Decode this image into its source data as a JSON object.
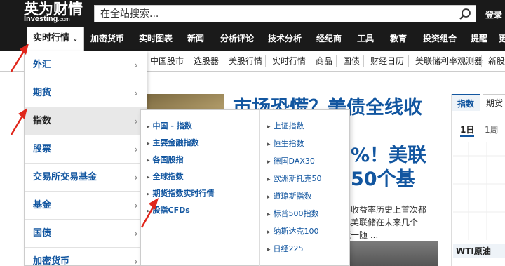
{
  "header": {
    "logo_cn": "英为财情",
    "logo_en": "Investing",
    "logo_en_suffix": ".com",
    "search_placeholder": "在全站搜索...",
    "login": "登录"
  },
  "main_nav": [
    {
      "label": "实时行情",
      "active": true
    },
    {
      "label": "加密货币"
    },
    {
      "label": "实时图表"
    },
    {
      "label": "新闻"
    },
    {
      "label": "分析评论"
    },
    {
      "label": "技术分析"
    },
    {
      "label": "经纪商"
    },
    {
      "label": "工具"
    },
    {
      "label": "教育"
    },
    {
      "label": "投资组合"
    },
    {
      "label": "提醒"
    },
    {
      "label": "更"
    }
  ],
  "sub_nav": [
    "中国股市",
    "选股器",
    "美股行情",
    "实时行情",
    "商品",
    "国债",
    "财经日历",
    "美联储利率观测器",
    "新股"
  ],
  "menu1": [
    {
      "label": "外汇"
    },
    {
      "label": "期货"
    },
    {
      "label": "指数",
      "active": true
    },
    {
      "label": "股票"
    },
    {
      "label": "交易所交易基金"
    },
    {
      "label": "基金"
    },
    {
      "label": "国债"
    },
    {
      "label": "加密货币"
    }
  ],
  "menu2_left": [
    {
      "label": "中国 - 指数"
    },
    {
      "label": "主要金融指数"
    },
    {
      "label": "各国股指"
    },
    {
      "label": "全球指数"
    },
    {
      "label": "期货指数实时行情",
      "highlight": true
    },
    {
      "label": "股指CFDs"
    }
  ],
  "menu2_right": [
    "上证指数",
    "恒生指数",
    "德国DAX30",
    "欧洲斯托克50",
    "道琼斯指数",
    "标普500指数",
    "纳斯达克100",
    "日经225"
  ],
  "article": {
    "headline_1": "市场恐慌？美债全线收益",
    "headline_2": "%！美联",
    "headline_3": "50个基",
    "snippet_1": "限收益率历史上首次都",
    "snippet_2": "化美联储在未来几个",
    "snippet_3": "慌一随 ..."
  },
  "right_widget": {
    "tab1": "指数",
    "tab2": "期货",
    "period1": "1日",
    "period2": "1周",
    "label": "WTI原油"
  },
  "colors": {
    "nav_bg": "#1a1a1a",
    "link": "#1256a0",
    "arrow": "#e0261b"
  }
}
